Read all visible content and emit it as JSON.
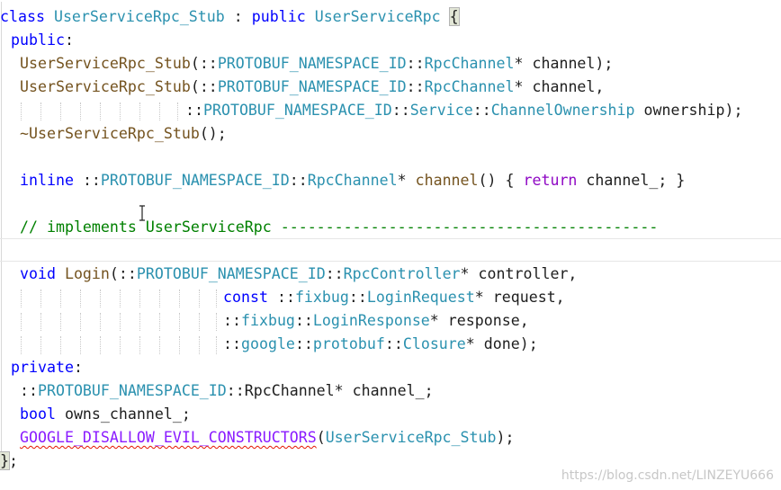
{
  "editor": {
    "lines": [
      {
        "indent": 0,
        "tokens": [
          [
            "kw",
            "class "
          ],
          [
            "ty",
            "UserServiceRpc_Stub"
          ],
          [
            "plain",
            " : "
          ],
          [
            "kw",
            "public "
          ],
          [
            "ty",
            "UserServiceRpc"
          ],
          [
            "plain",
            " "
          ],
          [
            "brace",
            "{"
          ]
        ]
      },
      {
        "indent": 12,
        "tokens": [
          [
            "kw",
            "public"
          ],
          [
            "plain",
            ":"
          ]
        ]
      },
      {
        "indent": 22,
        "tokens": [
          [
            "fn",
            "UserServiceRpc_Stub"
          ],
          [
            "plain",
            "(::"
          ],
          [
            "ty",
            "PROTOBUF_NAMESPACE_ID"
          ],
          [
            "plain",
            "::"
          ],
          [
            "ty",
            "RpcChannel"
          ],
          [
            "plain",
            "* channel);"
          ]
        ]
      },
      {
        "indent": 22,
        "tokens": [
          [
            "fn",
            "UserServiceRpc_Stub"
          ],
          [
            "plain",
            "(::"
          ],
          [
            "ty",
            "PROTOBUF_NAMESPACE_ID"
          ],
          [
            "plain",
            "::"
          ],
          [
            "ty",
            "RpcChannel"
          ],
          [
            "plain",
            "* channel,"
          ]
        ]
      },
      {
        "indent": 206,
        "tokens": [
          [
            "plain",
            "::"
          ],
          [
            "ty",
            "PROTOBUF_NAMESPACE_ID"
          ],
          [
            "plain",
            "::"
          ],
          [
            "ty",
            "Service"
          ],
          [
            "plain",
            "::"
          ],
          [
            "ty",
            "ChannelOwnership"
          ],
          [
            "plain",
            " ownership);"
          ]
        ]
      },
      {
        "indent": 22,
        "tokens": [
          [
            "fn",
            "~UserServiceRpc_Stub"
          ],
          [
            "plain",
            "();"
          ]
        ]
      },
      {
        "indent": 22,
        "tokens": []
      },
      {
        "indent": 22,
        "tokens": [
          [
            "kw",
            "inline "
          ],
          [
            "plain",
            "::"
          ],
          [
            "ty",
            "PROTOBUF_NAMESPACE_ID"
          ],
          [
            "plain",
            "::"
          ],
          [
            "ty",
            "RpcChannel"
          ],
          [
            "plain",
            "* "
          ],
          [
            "fn",
            "channel"
          ],
          [
            "plain",
            "() { "
          ],
          [
            "ctl",
            "return"
          ],
          [
            "plain",
            " channel_; }"
          ]
        ]
      },
      {
        "indent": 22,
        "tokens": []
      },
      {
        "indent": 22,
        "tokens": [
          [
            "cm",
            "// implements UserServiceRpc ------------------------------------------"
          ]
        ]
      },
      {
        "indent": 22,
        "tokens": []
      },
      {
        "indent": 22,
        "tokens": [
          [
            "kw",
            "void "
          ],
          [
            "fn",
            "Login"
          ],
          [
            "plain",
            "(::"
          ],
          [
            "ty",
            "PROTOBUF_NAMESPACE_ID"
          ],
          [
            "plain",
            "::"
          ],
          [
            "ty",
            "RpcController"
          ],
          [
            "plain",
            "* controller,"
          ]
        ]
      },
      {
        "indent": 248,
        "tokens": [
          [
            "kw",
            "const "
          ],
          [
            "plain",
            "::"
          ],
          [
            "ty",
            "fixbug"
          ],
          [
            "plain",
            "::"
          ],
          [
            "ty",
            "LoginRequest"
          ],
          [
            "plain",
            "* request,"
          ]
        ]
      },
      {
        "indent": 248,
        "tokens": [
          [
            "plain",
            "::"
          ],
          [
            "ty",
            "fixbug"
          ],
          [
            "plain",
            "::"
          ],
          [
            "ty",
            "LoginResponse"
          ],
          [
            "plain",
            "* response,"
          ]
        ]
      },
      {
        "indent": 248,
        "tokens": [
          [
            "plain",
            "::"
          ],
          [
            "ty",
            "google"
          ],
          [
            "plain",
            "::"
          ],
          [
            "ty",
            "protobuf"
          ],
          [
            "plain",
            "::"
          ],
          [
            "ty",
            "Closure"
          ],
          [
            "plain",
            "* done);"
          ]
        ]
      },
      {
        "indent": 12,
        "tokens": [
          [
            "kw",
            "private"
          ],
          [
            "plain",
            ":"
          ]
        ]
      },
      {
        "indent": 22,
        "tokens": [
          [
            "plain",
            "::"
          ],
          [
            "ty",
            "PROTOBUF_NAMESPACE_ID"
          ],
          [
            "plain",
            "::RpcChannel* channel_;"
          ]
        ]
      },
      {
        "indent": 22,
        "tokens": [
          [
            "kw",
            "bool "
          ],
          [
            "plain",
            "owns_channel_;"
          ]
        ]
      },
      {
        "indent": 22,
        "tokens": [
          [
            "macsq",
            "GOOGLE_DISALLOW_EVIL_CONSTRUCTORS"
          ],
          [
            "plain",
            "("
          ],
          [
            "ty",
            "UserServiceRpc_Stub"
          ],
          [
            "plain",
            ");"
          ]
        ]
      },
      {
        "indent": 0,
        "tokens": [
          [
            "brace",
            "}"
          ],
          [
            "plain",
            ";"
          ]
        ]
      }
    ]
  },
  "watermark": "https://blog.csdn.net/LINZEYU666",
  "colors": {
    "keyword": "#0000ff",
    "type": "#2b91af",
    "function": "#74531f",
    "control": "#8f08c4",
    "comment": "#008000",
    "macro": "#8a1bff"
  }
}
